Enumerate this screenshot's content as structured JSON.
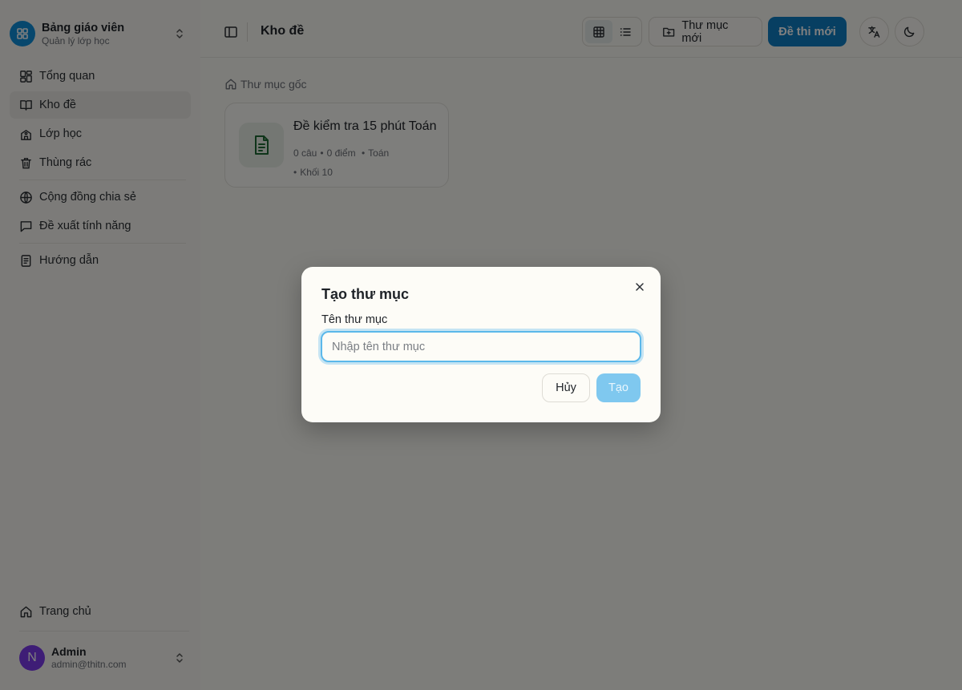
{
  "sidebar": {
    "brand": {
      "title": "Bảng giáo viên",
      "subtitle": "Quản lý lớp học"
    },
    "items": [
      {
        "label": "Tổng quan",
        "icon": "dashboard-icon"
      },
      {
        "label": "Kho đề",
        "icon": "book-icon"
      },
      {
        "label": "Lớp học",
        "icon": "school-icon"
      },
      {
        "label": "Thùng rác",
        "icon": "trash-icon"
      },
      {
        "label": "Cộng đồng chia sẻ",
        "icon": "globe-icon"
      },
      {
        "label": "Đề xuất tính năng",
        "icon": "message-icon"
      },
      {
        "label": "Hướng dẫn",
        "icon": "document-icon"
      }
    ],
    "home": {
      "label": "Trang chủ",
      "icon": "home-icon"
    },
    "user": {
      "initial": "N",
      "name": "Admin",
      "email": "admin@thitn.com"
    }
  },
  "header": {
    "title": "Kho đề",
    "new_folder_label": "Thư mục mới",
    "new_exam_label": "Đề thi mới"
  },
  "breadcrumb": {
    "root": "Thư mục gốc"
  },
  "exams": [
    {
      "title": "Đề kiểm tra 15 phút Toán",
      "questions": "0 câu",
      "points": "0 điểm",
      "subject": "Toán",
      "grade": "Khối 10"
    }
  ],
  "dialog": {
    "title": "Tạo thư mục",
    "field_label": "Tên thư mục",
    "placeholder": "Nhập tên thư mục",
    "value": "",
    "cancel_label": "Hủy",
    "create_label": "Tạo"
  },
  "colors": {
    "primary": "#0e7fc4",
    "brand": "#0f8fdb",
    "avatar": "#7c3aed",
    "focus": "#5bb8ea"
  }
}
